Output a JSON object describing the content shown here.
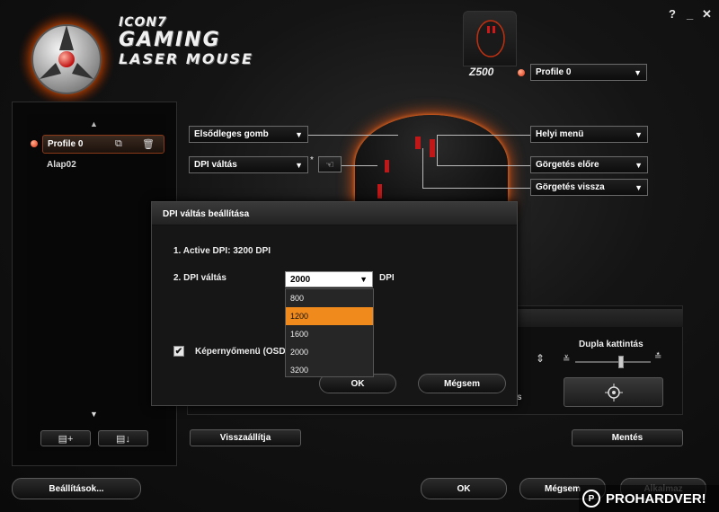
{
  "window_controls": {
    "help": "?",
    "minimize": "_",
    "close": "✕"
  },
  "logo": {
    "line1": "ICON7",
    "line2": "GAMING",
    "line3": "LASER MOUSE"
  },
  "header": {
    "model": "Z500",
    "profile_select": "Profile 0"
  },
  "profiles": {
    "items": [
      {
        "label": "Profile 0",
        "active": true
      },
      {
        "label": "Alap02",
        "active": false
      }
    ],
    "add_icon": "new-profile-icon",
    "import_icon": "import-profile-icon"
  },
  "button_mapping": {
    "left1": "Elsődleges gomb",
    "left2": "DPI váltás",
    "right1": "Helyi menü",
    "right2": "Görgetés előre",
    "right3": "Görgetés vissza",
    "star": "*"
  },
  "dialog": {
    "title": "DPI váltás beállítása",
    "line1": "1. Active DPI: 3200 DPI",
    "line2_label": "2. DPI váltás",
    "dpi_value": "2000",
    "dpi_unit": "DPI",
    "dpi_options": [
      "800",
      "1200",
      "1600",
      "2000",
      "3200"
    ],
    "dpi_highlighted": "1200",
    "osd_label": "Képernyőmenü (OSD",
    "ok": "OK",
    "cancel": "Mégsem"
  },
  "background_panel": {
    "double_click": "Dupla kattintás",
    "partial_text": "s",
    "double_click_slider": 0.6
  },
  "footer": {
    "reset": "Visszaállítja",
    "save": "Mentés",
    "settings": "Beállítások...",
    "ok": "OK",
    "cancel": "Mégsem",
    "apply": "Alkalmaz"
  },
  "watermark": "PROHARDVER!",
  "colors": {
    "accent": "#f08a1c",
    "glow": "#ff5a10",
    "status_dot": "#e03010"
  }
}
